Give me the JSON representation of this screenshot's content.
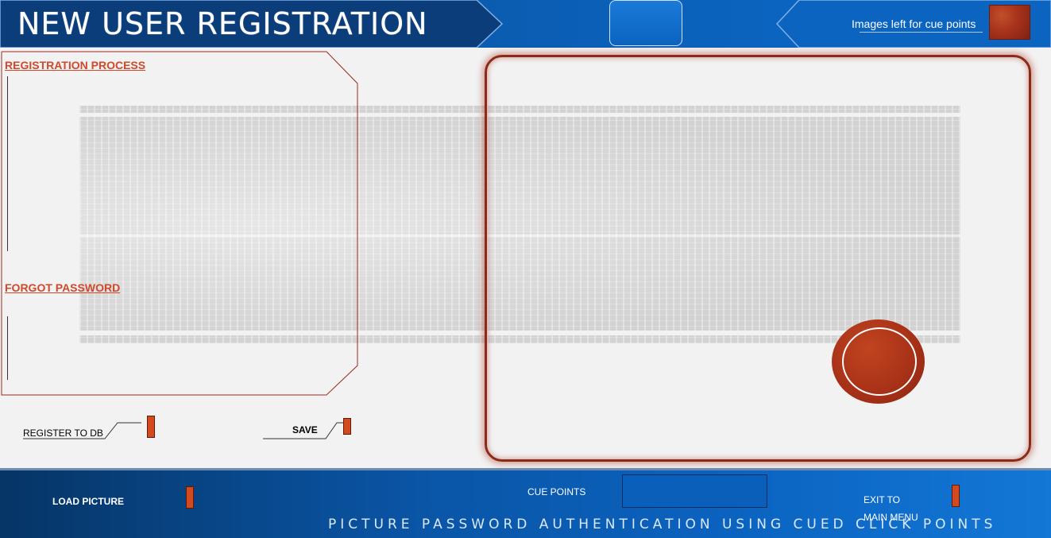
{
  "header": {
    "title": "NEW USER REGISTRATION",
    "images_left_label": "Images left for cue points"
  },
  "left_panel": {
    "registration_process": "REGISTRATION PROCESS",
    "forgot_password": "FORGOT PASSWORD"
  },
  "actions": {
    "register_to_db": "REGISTER TO DB",
    "save": "SAVE"
  },
  "footer": {
    "load_picture": "LOAD PICTURE",
    "cue_points": "CUE POINTS",
    "exit_to": "EXIT TO",
    "main_menu": "MAIN MENU",
    "caption": "PICTURE PASSWORD AUTHENTICATION USING CUED CLICK POINTS"
  },
  "colors": {
    "header_blue": "#0b5cb0",
    "accent_orange": "#d44a1e",
    "link_red": "#d0492a",
    "frame_red": "#8c2a1a"
  }
}
